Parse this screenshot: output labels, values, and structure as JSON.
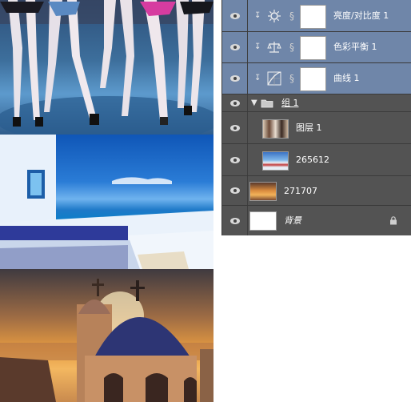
{
  "layers_panel": {
    "layers": [
      {
        "name": "亮度/对比度 1",
        "kind": "adjustment",
        "icon": "brightness-contrast-icon",
        "clipped": true,
        "selected": true,
        "visible": true
      },
      {
        "name": "色彩平衡 1",
        "kind": "adjustment",
        "icon": "color-balance-icon",
        "clipped": true,
        "selected": true,
        "visible": true
      },
      {
        "name": "曲线 1",
        "kind": "adjustment",
        "icon": "curves-icon",
        "clipped": true,
        "selected": true,
        "visible": true
      },
      {
        "name": "组 1",
        "kind": "group",
        "icon": "folder-icon",
        "expanded": true,
        "visible": true
      },
      {
        "name": "图层 1",
        "kind": "pixel",
        "icon": "layer-thumbnail",
        "visible": true
      },
      {
        "name": "265612",
        "kind": "pixel",
        "icon": "layer-thumbnail",
        "visible": true
      },
      {
        "name": "271707",
        "kind": "pixel",
        "icon": "layer-thumbnail",
        "visible": true
      },
      {
        "name": "背景",
        "kind": "background",
        "icon": "layer-thumbnail",
        "locked": true,
        "visible": true
      }
    ]
  },
  "colors": {
    "panel_bg": "#535353",
    "selected_row": "#6f86a9",
    "divider": "#3a3a3a",
    "label_text": "#ffffff"
  }
}
